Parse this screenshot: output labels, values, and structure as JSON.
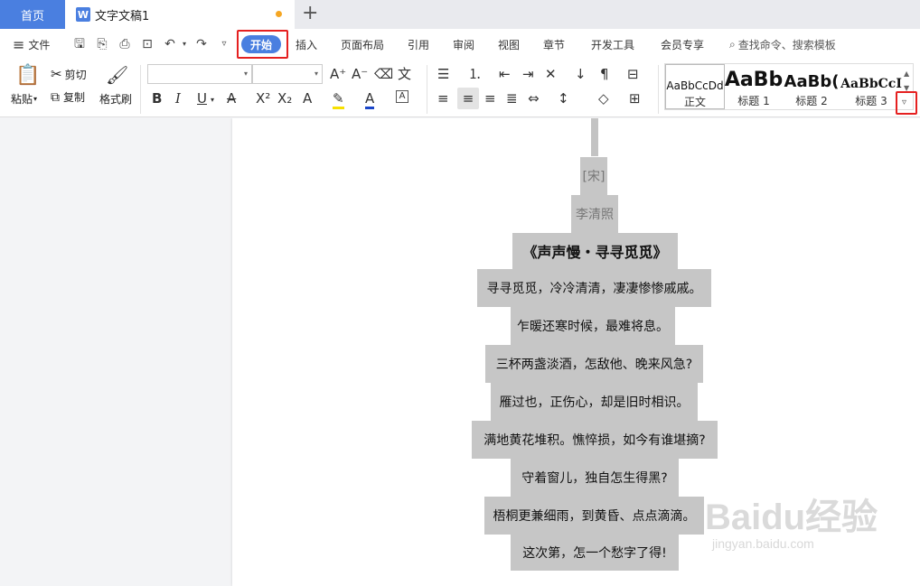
{
  "tabs": {
    "home": "首页",
    "doc_icon": "W",
    "doc_title": "文字文稿1",
    "new_tab": "+"
  },
  "menu": {
    "hamburger": "≡",
    "file": "文件",
    "items": [
      "开始",
      "插入",
      "页面布局",
      "引用",
      "审阅",
      "视图",
      "章节",
      "开发工具",
      "会员专享"
    ],
    "search": "查找命令、搜索模板"
  },
  "ribbon": {
    "paste": "粘贴",
    "cut": "剪切",
    "copy": "复制",
    "format_painter": "格式刷",
    "styles": [
      {
        "preview": "AaBbCcDd",
        "label": "正文"
      },
      {
        "preview": "AaBb",
        "label": "标题 1"
      },
      {
        "preview": "AaBb(",
        "label": "标题 2"
      },
      {
        "preview": "AaBbCcI",
        "label": "标题 3"
      }
    ]
  },
  "document": {
    "lines": [
      "[宋]",
      "李清照",
      "《声声慢・寻寻觅觅》",
      "寻寻觅觅，冷冷清清，凄凄惨惨戚戚。",
      "乍暖还寒时候，最难将息。",
      "三杯两盏淡酒，怎敌他、晚来风急?",
      "雁过也，正伤心，却是旧时相识。",
      "满地黄花堆积。憔悴损，如今有谁堪摘?",
      "守着窗儿，独自怎生得黑?",
      "梧桐更兼细雨，到黄昏、点点滴滴。",
      "这次第，怎一个愁字了得!"
    ]
  },
  "watermark": {
    "brand": "Baidu经验",
    "url": "jingyan.baidu.com"
  },
  "colors": {
    "accent": "#4a7fe0",
    "highlight_box": "#e52020",
    "text_shading": "#c6c6c6"
  }
}
